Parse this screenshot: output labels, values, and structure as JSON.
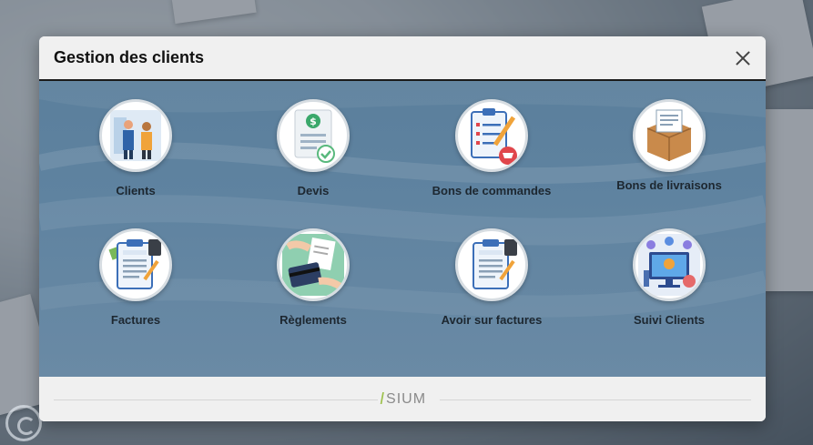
{
  "modal": {
    "title": "Gestion des clients"
  },
  "tiles": [
    {
      "label": "Clients",
      "icon": "clients-icon"
    },
    {
      "label": "Devis",
      "icon": "quote-icon"
    },
    {
      "label": "Bons de commandes",
      "icon": "purchase-order-icon"
    },
    {
      "label": "Bons de livraisons",
      "icon": "delivery-box-icon"
    },
    {
      "label": "Factures",
      "icon": "invoice-icon"
    },
    {
      "label": "Règlements",
      "icon": "payment-card-icon"
    },
    {
      "label": "Avoir sur factures",
      "icon": "credit-note-icon"
    },
    {
      "label": "Suivi Clients",
      "icon": "customer-tracking-icon"
    }
  ],
  "footer": {
    "logo_text": "SIUM",
    "logo_mark": "I"
  },
  "colors": {
    "body_bg": "#5f83a0",
    "header_bg": "#f0f0f0",
    "logo_accent": "#9cc04a"
  }
}
